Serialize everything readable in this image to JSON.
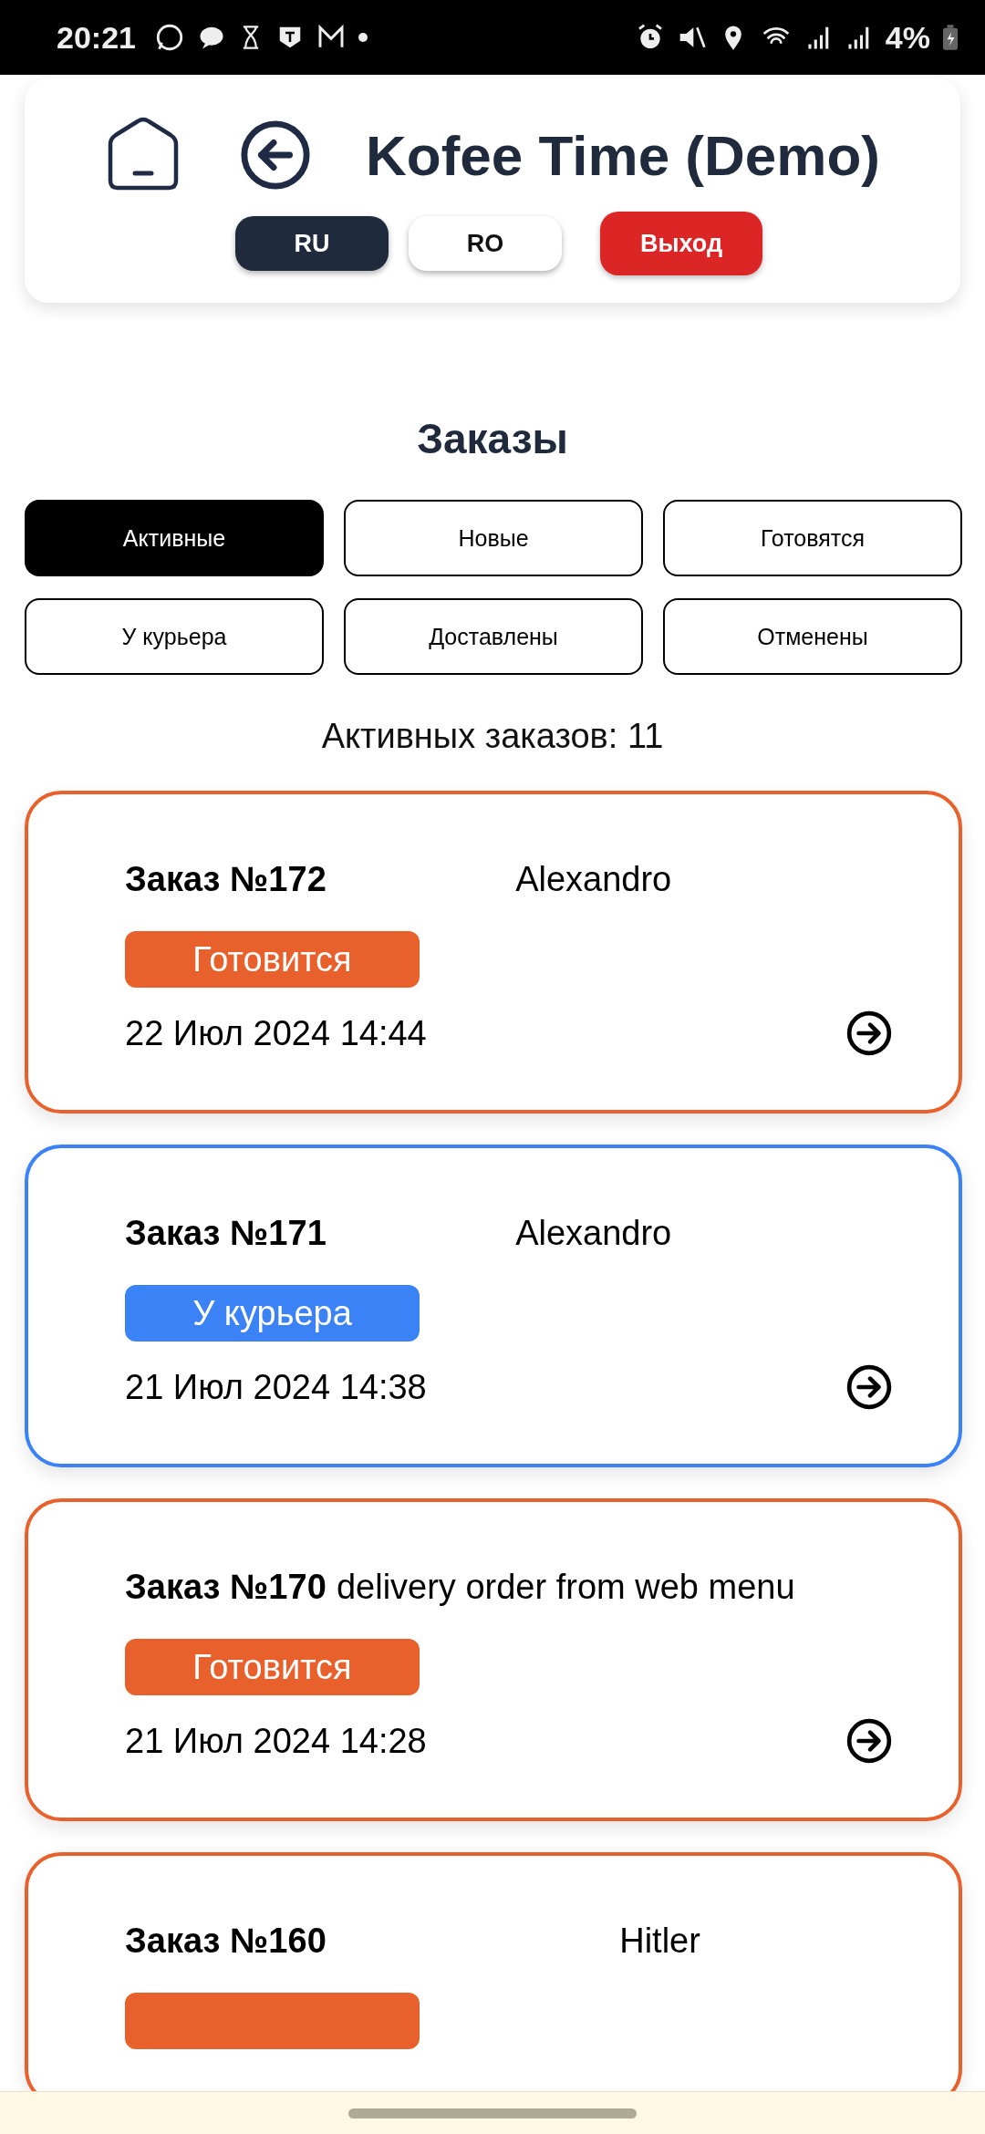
{
  "status_bar": {
    "time": "20:21",
    "battery": "4%"
  },
  "header": {
    "title": "Kofee Time (Demo)",
    "languages": [
      {
        "label": "RU",
        "selected": true
      },
      {
        "label": "RO",
        "selected": false
      }
    ],
    "logout": "Выход"
  },
  "orders_title": "Заказы",
  "filters": [
    {
      "label": "Активные",
      "selected": true
    },
    {
      "label": "Новые",
      "selected": false
    },
    {
      "label": "Готовятся",
      "selected": false
    },
    {
      "label": "У курьера",
      "selected": false
    },
    {
      "label": "Доставлены",
      "selected": false
    },
    {
      "label": "Отменены",
      "selected": false
    }
  ],
  "count": "Активных заказов: 11",
  "orders": [
    {
      "number": "Заказ №172",
      "customer": "Alexandro",
      "status": "Готовится",
      "color": "#e8612c",
      "date": "22 Июл 2024 14:44"
    },
    {
      "number": "Заказ №171",
      "customer": "Alexandro",
      "status": "У курьера",
      "color": "#3b82f6",
      "date": "21 Июл 2024 14:38"
    },
    {
      "number": "Заказ №170",
      "customer": "delivery order from web menu",
      "status": "Готовится",
      "color": "#e8612c",
      "date": "21 Июл 2024 14:28"
    },
    {
      "number": "Заказ №160",
      "customer": "Hitler",
      "color": "#e8612c"
    }
  ]
}
